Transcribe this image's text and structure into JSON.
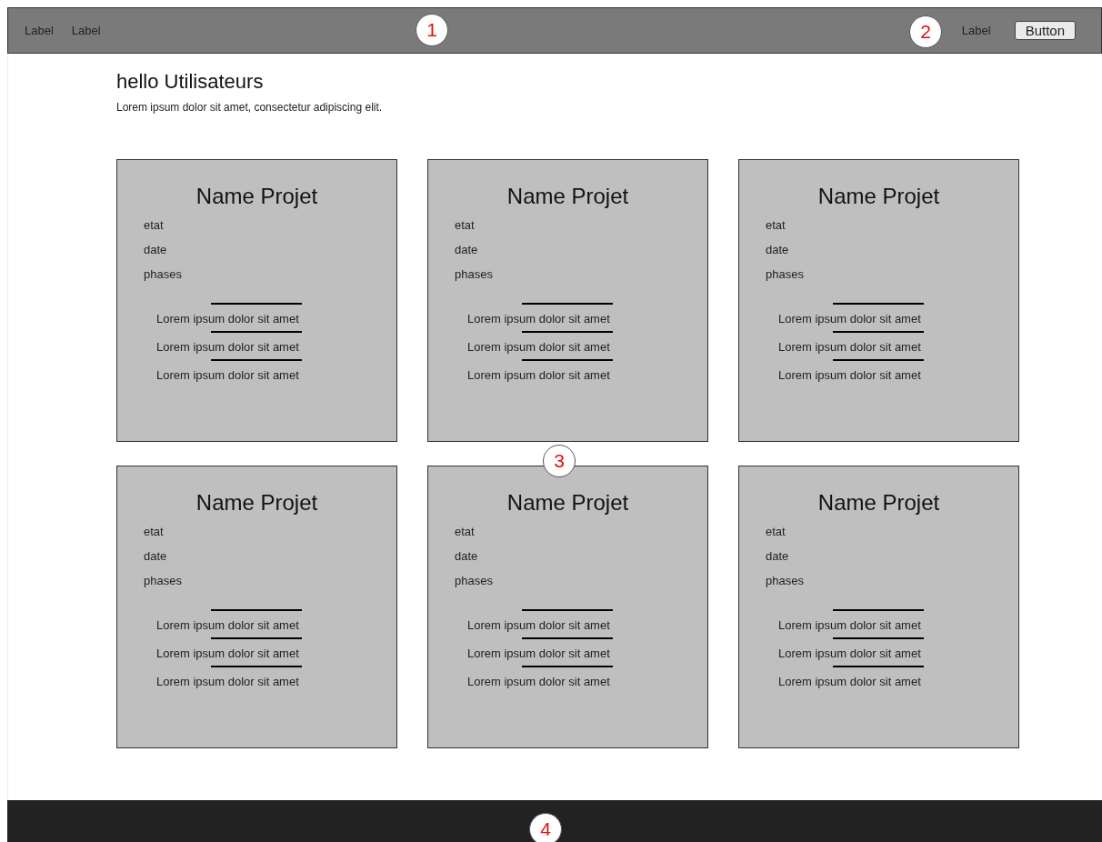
{
  "top_bar": {
    "left_labels": [
      "Label",
      "Label"
    ],
    "right_label": "Label",
    "button": "Button"
  },
  "header": {
    "title": "hello Utilisateurs",
    "subtitle": "Lorem ipsum dolor sit amet, consectetur adipiscing elit."
  },
  "projects": [
    {
      "name": "Name Projet",
      "fields": [
        "etat",
        "date",
        "phases"
      ],
      "lines": [
        "Lorem ipsum dolor sit amet",
        "Lorem ipsum dolor sit amet",
        "Lorem ipsum dolor sit amet"
      ]
    },
    {
      "name": "Name Projet",
      "fields": [
        "etat",
        "date",
        "phases"
      ],
      "lines": [
        "Lorem ipsum dolor sit amet",
        "Lorem ipsum dolor sit amet",
        "Lorem ipsum dolor sit amet"
      ]
    },
    {
      "name": "Name Projet",
      "fields": [
        "etat",
        "date",
        "phases"
      ],
      "lines": [
        "Lorem ipsum dolor sit amet",
        "Lorem ipsum dolor sit amet",
        "Lorem ipsum dolor sit amet"
      ]
    },
    {
      "name": "Name Projet",
      "fields": [
        "etat",
        "date",
        "phases"
      ],
      "lines": [
        "Lorem ipsum dolor sit amet",
        "Lorem ipsum dolor sit amet",
        "Lorem ipsum dolor sit amet"
      ]
    },
    {
      "name": "Name Projet",
      "fields": [
        "etat",
        "date",
        "phases"
      ],
      "lines": [
        "Lorem ipsum dolor sit amet",
        "Lorem ipsum dolor sit amet",
        "Lorem ipsum dolor sit amet"
      ]
    },
    {
      "name": "Name Projet",
      "fields": [
        "etat",
        "date",
        "phases"
      ],
      "lines": [
        "Lorem ipsum dolor sit amet",
        "Lorem ipsum dolor sit amet",
        "Lorem ipsum dolor sit amet"
      ]
    }
  ],
  "callouts": [
    "1",
    "2",
    "3",
    "4"
  ]
}
